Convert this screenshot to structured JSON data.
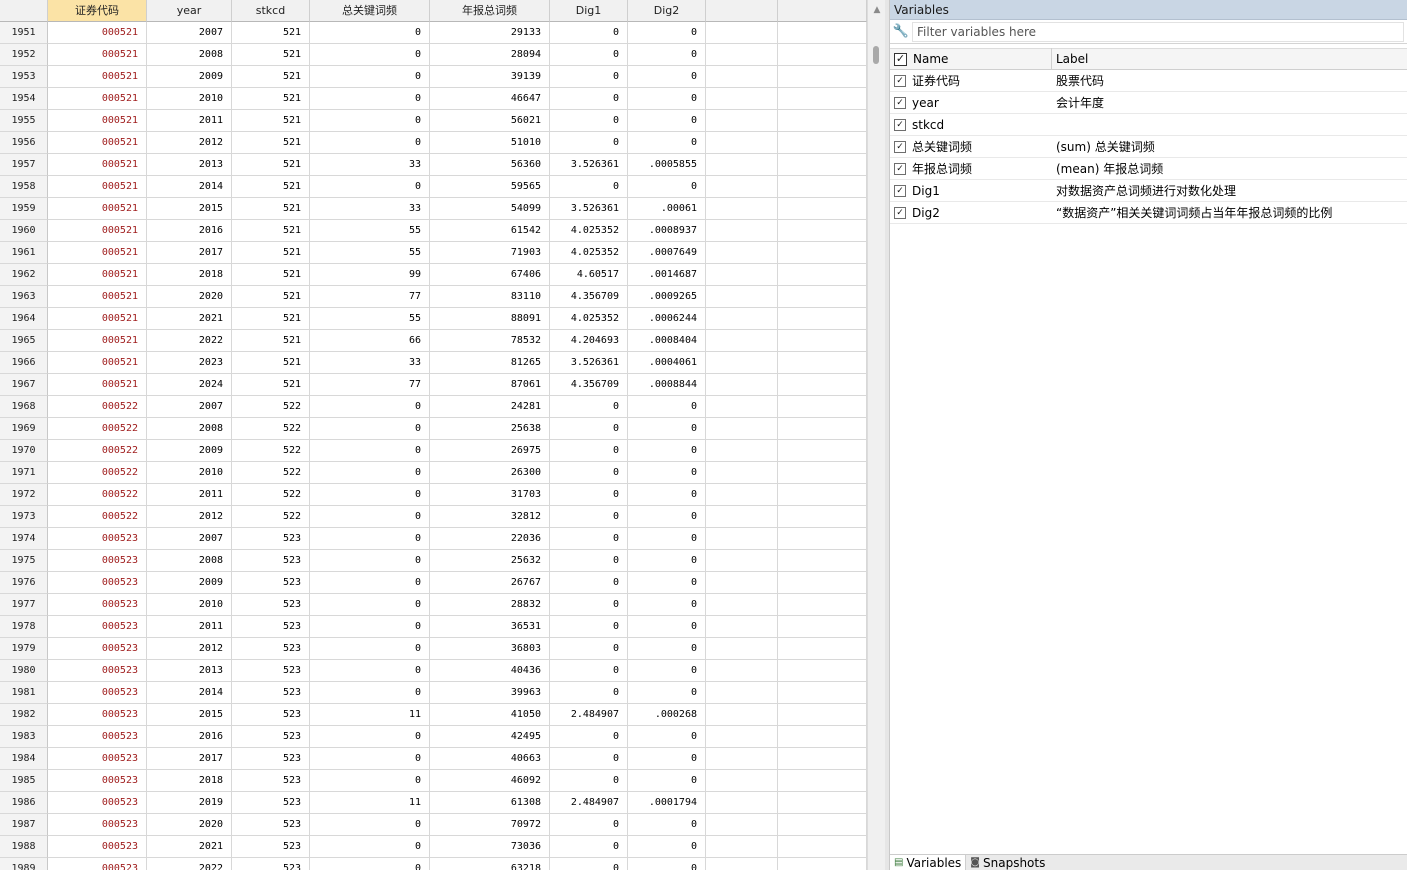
{
  "grid": {
    "columns": [
      "证券代码",
      "year",
      "stkcd",
      "总关键词频",
      "年报总词频",
      "Dig1",
      "Dig2"
    ],
    "selected_column": 0,
    "rows": [
      [
        "1951",
        "000521",
        "2007",
        "521",
        "0",
        "29133",
        "0",
        "0"
      ],
      [
        "1952",
        "000521",
        "2008",
        "521",
        "0",
        "28094",
        "0",
        "0"
      ],
      [
        "1953",
        "000521",
        "2009",
        "521",
        "0",
        "39139",
        "0",
        "0"
      ],
      [
        "1954",
        "000521",
        "2010",
        "521",
        "0",
        "46647",
        "0",
        "0"
      ],
      [
        "1955",
        "000521",
        "2011",
        "521",
        "0",
        "56021",
        "0",
        "0"
      ],
      [
        "1956",
        "000521",
        "2012",
        "521",
        "0",
        "51010",
        "0",
        "0"
      ],
      [
        "1957",
        "000521",
        "2013",
        "521",
        "33",
        "56360",
        "3.526361",
        ".0005855"
      ],
      [
        "1958",
        "000521",
        "2014",
        "521",
        "0",
        "59565",
        "0",
        "0"
      ],
      [
        "1959",
        "000521",
        "2015",
        "521",
        "33",
        "54099",
        "3.526361",
        ".00061"
      ],
      [
        "1960",
        "000521",
        "2016",
        "521",
        "55",
        "61542",
        "4.025352",
        ".0008937"
      ],
      [
        "1961",
        "000521",
        "2017",
        "521",
        "55",
        "71903",
        "4.025352",
        ".0007649"
      ],
      [
        "1962",
        "000521",
        "2018",
        "521",
        "99",
        "67406",
        "4.60517",
        ".0014687"
      ],
      [
        "1963",
        "000521",
        "2020",
        "521",
        "77",
        "83110",
        "4.356709",
        ".0009265"
      ],
      [
        "1964",
        "000521",
        "2021",
        "521",
        "55",
        "88091",
        "4.025352",
        ".0006244"
      ],
      [
        "1965",
        "000521",
        "2022",
        "521",
        "66",
        "78532",
        "4.204693",
        ".0008404"
      ],
      [
        "1966",
        "000521",
        "2023",
        "521",
        "33",
        "81265",
        "3.526361",
        ".0004061"
      ],
      [
        "1967",
        "000521",
        "2024",
        "521",
        "77",
        "87061",
        "4.356709",
        ".0008844"
      ],
      [
        "1968",
        "000522",
        "2007",
        "522",
        "0",
        "24281",
        "0",
        "0"
      ],
      [
        "1969",
        "000522",
        "2008",
        "522",
        "0",
        "25638",
        "0",
        "0"
      ],
      [
        "1970",
        "000522",
        "2009",
        "522",
        "0",
        "26975",
        "0",
        "0"
      ],
      [
        "1971",
        "000522",
        "2010",
        "522",
        "0",
        "26300",
        "0",
        "0"
      ],
      [
        "1972",
        "000522",
        "2011",
        "522",
        "0",
        "31703",
        "0",
        "0"
      ],
      [
        "1973",
        "000522",
        "2012",
        "522",
        "0",
        "32812",
        "0",
        "0"
      ],
      [
        "1974",
        "000523",
        "2007",
        "523",
        "0",
        "22036",
        "0",
        "0"
      ],
      [
        "1975",
        "000523",
        "2008",
        "523",
        "0",
        "25632",
        "0",
        "0"
      ],
      [
        "1976",
        "000523",
        "2009",
        "523",
        "0",
        "26767",
        "0",
        "0"
      ],
      [
        "1977",
        "000523",
        "2010",
        "523",
        "0",
        "28832",
        "0",
        "0"
      ],
      [
        "1978",
        "000523",
        "2011",
        "523",
        "0",
        "36531",
        "0",
        "0"
      ],
      [
        "1979",
        "000523",
        "2012",
        "523",
        "0",
        "36803",
        "0",
        "0"
      ],
      [
        "1980",
        "000523",
        "2013",
        "523",
        "0",
        "40436",
        "0",
        "0"
      ],
      [
        "1981",
        "000523",
        "2014",
        "523",
        "0",
        "39963",
        "0",
        "0"
      ],
      [
        "1982",
        "000523",
        "2015",
        "523",
        "11",
        "41050",
        "2.484907",
        ".000268"
      ],
      [
        "1983",
        "000523",
        "2016",
        "523",
        "0",
        "42495",
        "0",
        "0"
      ],
      [
        "1984",
        "000523",
        "2017",
        "523",
        "0",
        "40663",
        "0",
        "0"
      ],
      [
        "1985",
        "000523",
        "2018",
        "523",
        "0",
        "46092",
        "0",
        "0"
      ],
      [
        "1986",
        "000523",
        "2019",
        "523",
        "11",
        "61308",
        "2.484907",
        ".0001794"
      ],
      [
        "1987",
        "000523",
        "2020",
        "523",
        "0",
        "70972",
        "0",
        "0"
      ],
      [
        "1988",
        "000523",
        "2021",
        "523",
        "0",
        "73036",
        "0",
        "0"
      ],
      [
        "1989",
        "000523",
        "2022",
        "523",
        "0",
        "63218",
        "0",
        "0"
      ]
    ]
  },
  "scrollbar": {
    "up_arrow_icon": "triangle-up-icon"
  },
  "variables_panel": {
    "title": "Variables",
    "filter_placeholder": "Filter variables here",
    "filter_icon": "wrench-icon",
    "header_name": "Name",
    "header_label": "Label",
    "items": [
      {
        "name": "证券代码",
        "label": "股票代码"
      },
      {
        "name": "year",
        "label": "会计年度"
      },
      {
        "name": "stkcd",
        "label": ""
      },
      {
        "name": "总关键词频",
        "label": "(sum) 总关键词频"
      },
      {
        "name": "年报总词频",
        "label": "(mean) 年报总词频"
      },
      {
        "name": "Dig1",
        "label": "对数据资产总词频进行对数化处理"
      },
      {
        "name": "Dig2",
        "label": "“数据资产”相关关键词词频占当年年报总词频的比例"
      }
    ],
    "tabs": [
      {
        "label": "Variables",
        "icon": "variables-icon"
      },
      {
        "label": "Snapshots",
        "icon": "camera-icon"
      }
    ]
  }
}
